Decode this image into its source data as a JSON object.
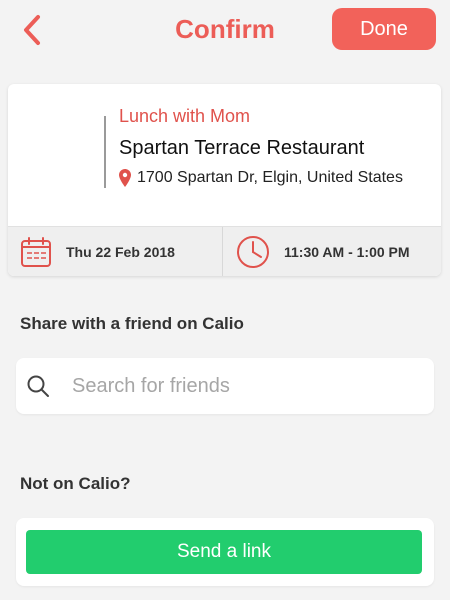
{
  "nav": {
    "title": "Confirm",
    "done_label": "Done",
    "back_icon": "chevron-left-icon"
  },
  "event": {
    "title": "Lunch with Mom",
    "venue": "Spartan Terrace Restaurant",
    "address": "1700 Spartan Dr, Elgin, United States",
    "date": "Thu 22 Feb 2018",
    "time": "11:30 AM - 1:00 PM"
  },
  "share": {
    "label": "Share with a friend on Calio",
    "search_placeholder": "Search for friends",
    "search_value": ""
  },
  "invite": {
    "label": "Not on Calio?",
    "button_label": "Send a link"
  },
  "colors": {
    "accent": "#ec5d57",
    "done_bg": "#f2625a",
    "send_bg": "#22cd6e",
    "background": "#f3f3f3"
  }
}
